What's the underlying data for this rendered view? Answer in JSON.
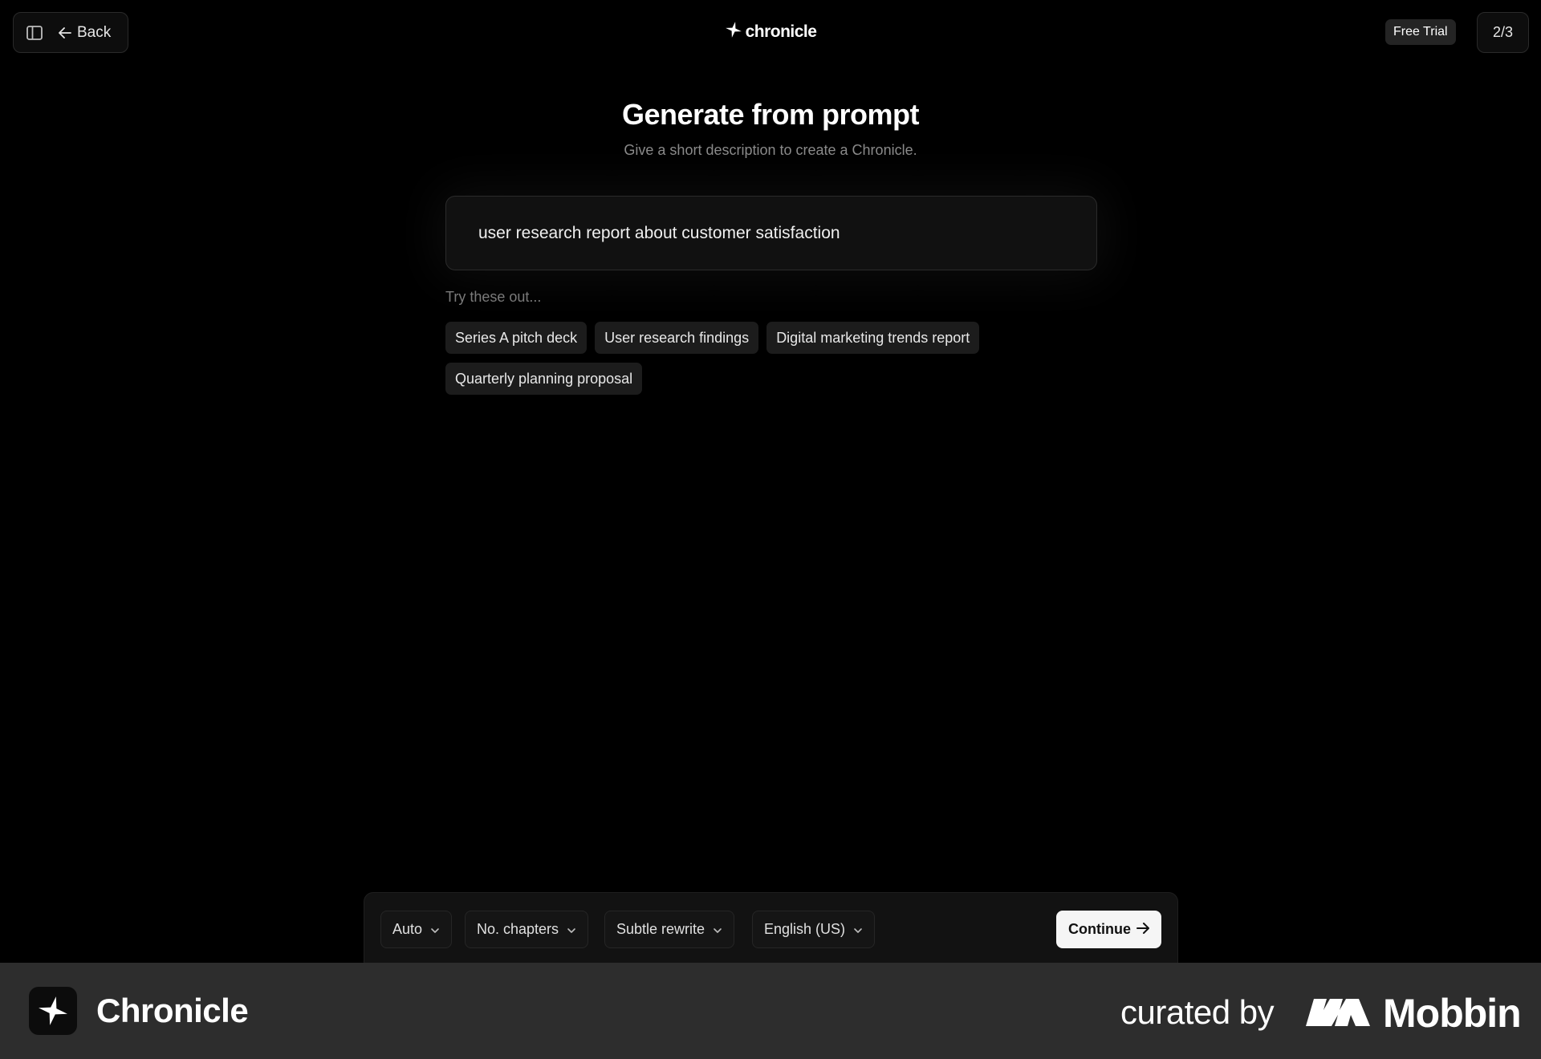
{
  "header": {
    "back_label": "Back",
    "logo_text": "chronicle",
    "free_trial_label": "Free Trial",
    "page_counter": "2/3"
  },
  "main": {
    "title": "Generate from prompt",
    "subtitle": "Give a short description to create a Chronicle.",
    "prompt_value": "user research report about customer satisfaction",
    "try_label": "Try these out...",
    "suggestions": [
      "Series A pitch deck",
      "User research findings",
      "Digital marketing trends report",
      "Quarterly planning proposal"
    ]
  },
  "options": {
    "dropdowns": [
      "Auto",
      "No. chapters",
      "Subtle rewrite",
      "English (US)"
    ],
    "continue_label": "Continue"
  },
  "footer": {
    "app_name": "Chronicle",
    "curated_by": "curated by",
    "brand_name": "Mobbin"
  },
  "colors": {
    "background": "#000000",
    "surface": "#121212",
    "chip": "#1c1c1c",
    "footer": "#2d2d2d",
    "primary_button": "#f5f5f5"
  }
}
